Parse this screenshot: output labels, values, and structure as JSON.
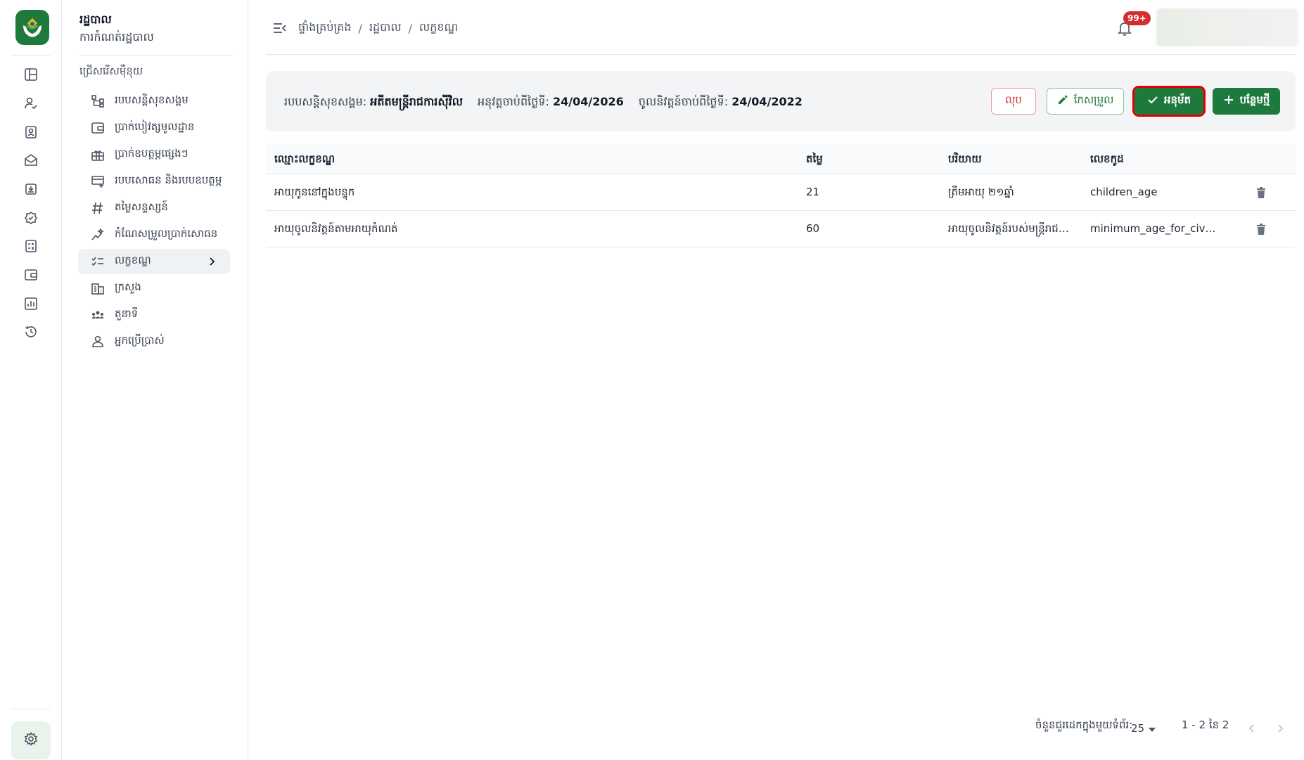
{
  "colors": {
    "brand_green": "#1e7a3c",
    "danger_red": "#d32f2f",
    "highlight_border": "#e00000",
    "active_bg": "#eef2f5"
  },
  "rail": {
    "logo": "app-logo-hands-icon",
    "icons": [
      "dashboard-icon",
      "user-check-icon",
      "id-card-icon",
      "mail-open-icon",
      "download-box-icon",
      "verified-badge-icon",
      "calculator-icon",
      "wallet-icon",
      "bar-chart-icon",
      "history-icon"
    ],
    "settings_icon": "gear-icon"
  },
  "sidebar": {
    "title": "រដ្ឋបាល",
    "subtitle": "ការកំណត់រដ្ឋបាល",
    "section_label": "ជ្រើសរើសម៉ឺនុយ",
    "items": [
      {
        "label": "របបសន្តិសុខសង្គម",
        "icon": "hierarchy-icon"
      },
      {
        "label": "ប្រាក់បៀវត្សមូលដ្ឋាន",
        "icon": "wallet-icon"
      },
      {
        "label": "ប្រាក់ឧបត្ថម្ភផ្សេងៗ",
        "icon": "gift-box-icon"
      },
      {
        "label": "របបសោធន និងរបបឧបត្ថម្ភ",
        "icon": "card-add-icon"
      },
      {
        "label": "តម្លៃសន្ទស្សន៍",
        "icon": "hash-icon"
      },
      {
        "label": "កំណែសម្រួលប្រាក់សោធន",
        "icon": "sparkle-chart-icon"
      },
      {
        "label": "លក្ខខណ្ឌ",
        "icon": "checklist-icon",
        "active": true
      },
      {
        "label": "ក្រសួង",
        "icon": "building-icon"
      },
      {
        "label": "តួនាទី",
        "icon": "group-icon"
      },
      {
        "label": "អ្នកប្រើប្រាស់",
        "icon": "person-icon"
      }
    ]
  },
  "header": {
    "breadcrumbs": [
      "ផ្ទាំងគ្រប់គ្រង",
      "រដ្ឋបាល",
      "លក្ខខណ្ឌ"
    ],
    "notification_count": "99+"
  },
  "info": {
    "scheme_label": "របបសន្តិសុខសង្គម:",
    "scheme_value": "អតីតមន្ត្រីរាជការស៊ីវិល",
    "effective_label": "អនុវត្តចាប់ពីថ្ងៃទី:",
    "effective_value": "24/04/2026",
    "retire_label": "ចូលនិវត្តន៍ចាប់ពីថ្ងៃទី:",
    "retire_value": "24/04/2022"
  },
  "actions": {
    "delete": "លុប",
    "edit": "កែសម្រួល",
    "approve": "អនុម័ត",
    "add": "បន្ថែមថ្មី"
  },
  "table": {
    "headers": {
      "name": "ឈ្មោះលក្ខខណ្ឌ",
      "value": "តម្លៃ",
      "desc": "បរិយាយ",
      "code": "លេខកូដ"
    },
    "rows": [
      {
        "name": "អាយុកូននៅក្នុងបន្ទុក",
        "value": "21",
        "desc": "ត្រឹមអាយុ ២១ឆ្នាំ",
        "code": "children_age"
      },
      {
        "name": "អាយុចូលនិវត្តន៍តាមអាយុកំណត់",
        "value": "60",
        "desc": "អាយុចូលនិវត្តន៍របស់មន្ត្រីរាជការ...",
        "code": "minimum_age_for_civil_s..."
      }
    ]
  },
  "pagination": {
    "rows_label": "ចំនួនជួរដេកក្នុងមួយទំព័រ:",
    "rows_per_page": "25",
    "range": "1 - 2 នៃ 2"
  }
}
